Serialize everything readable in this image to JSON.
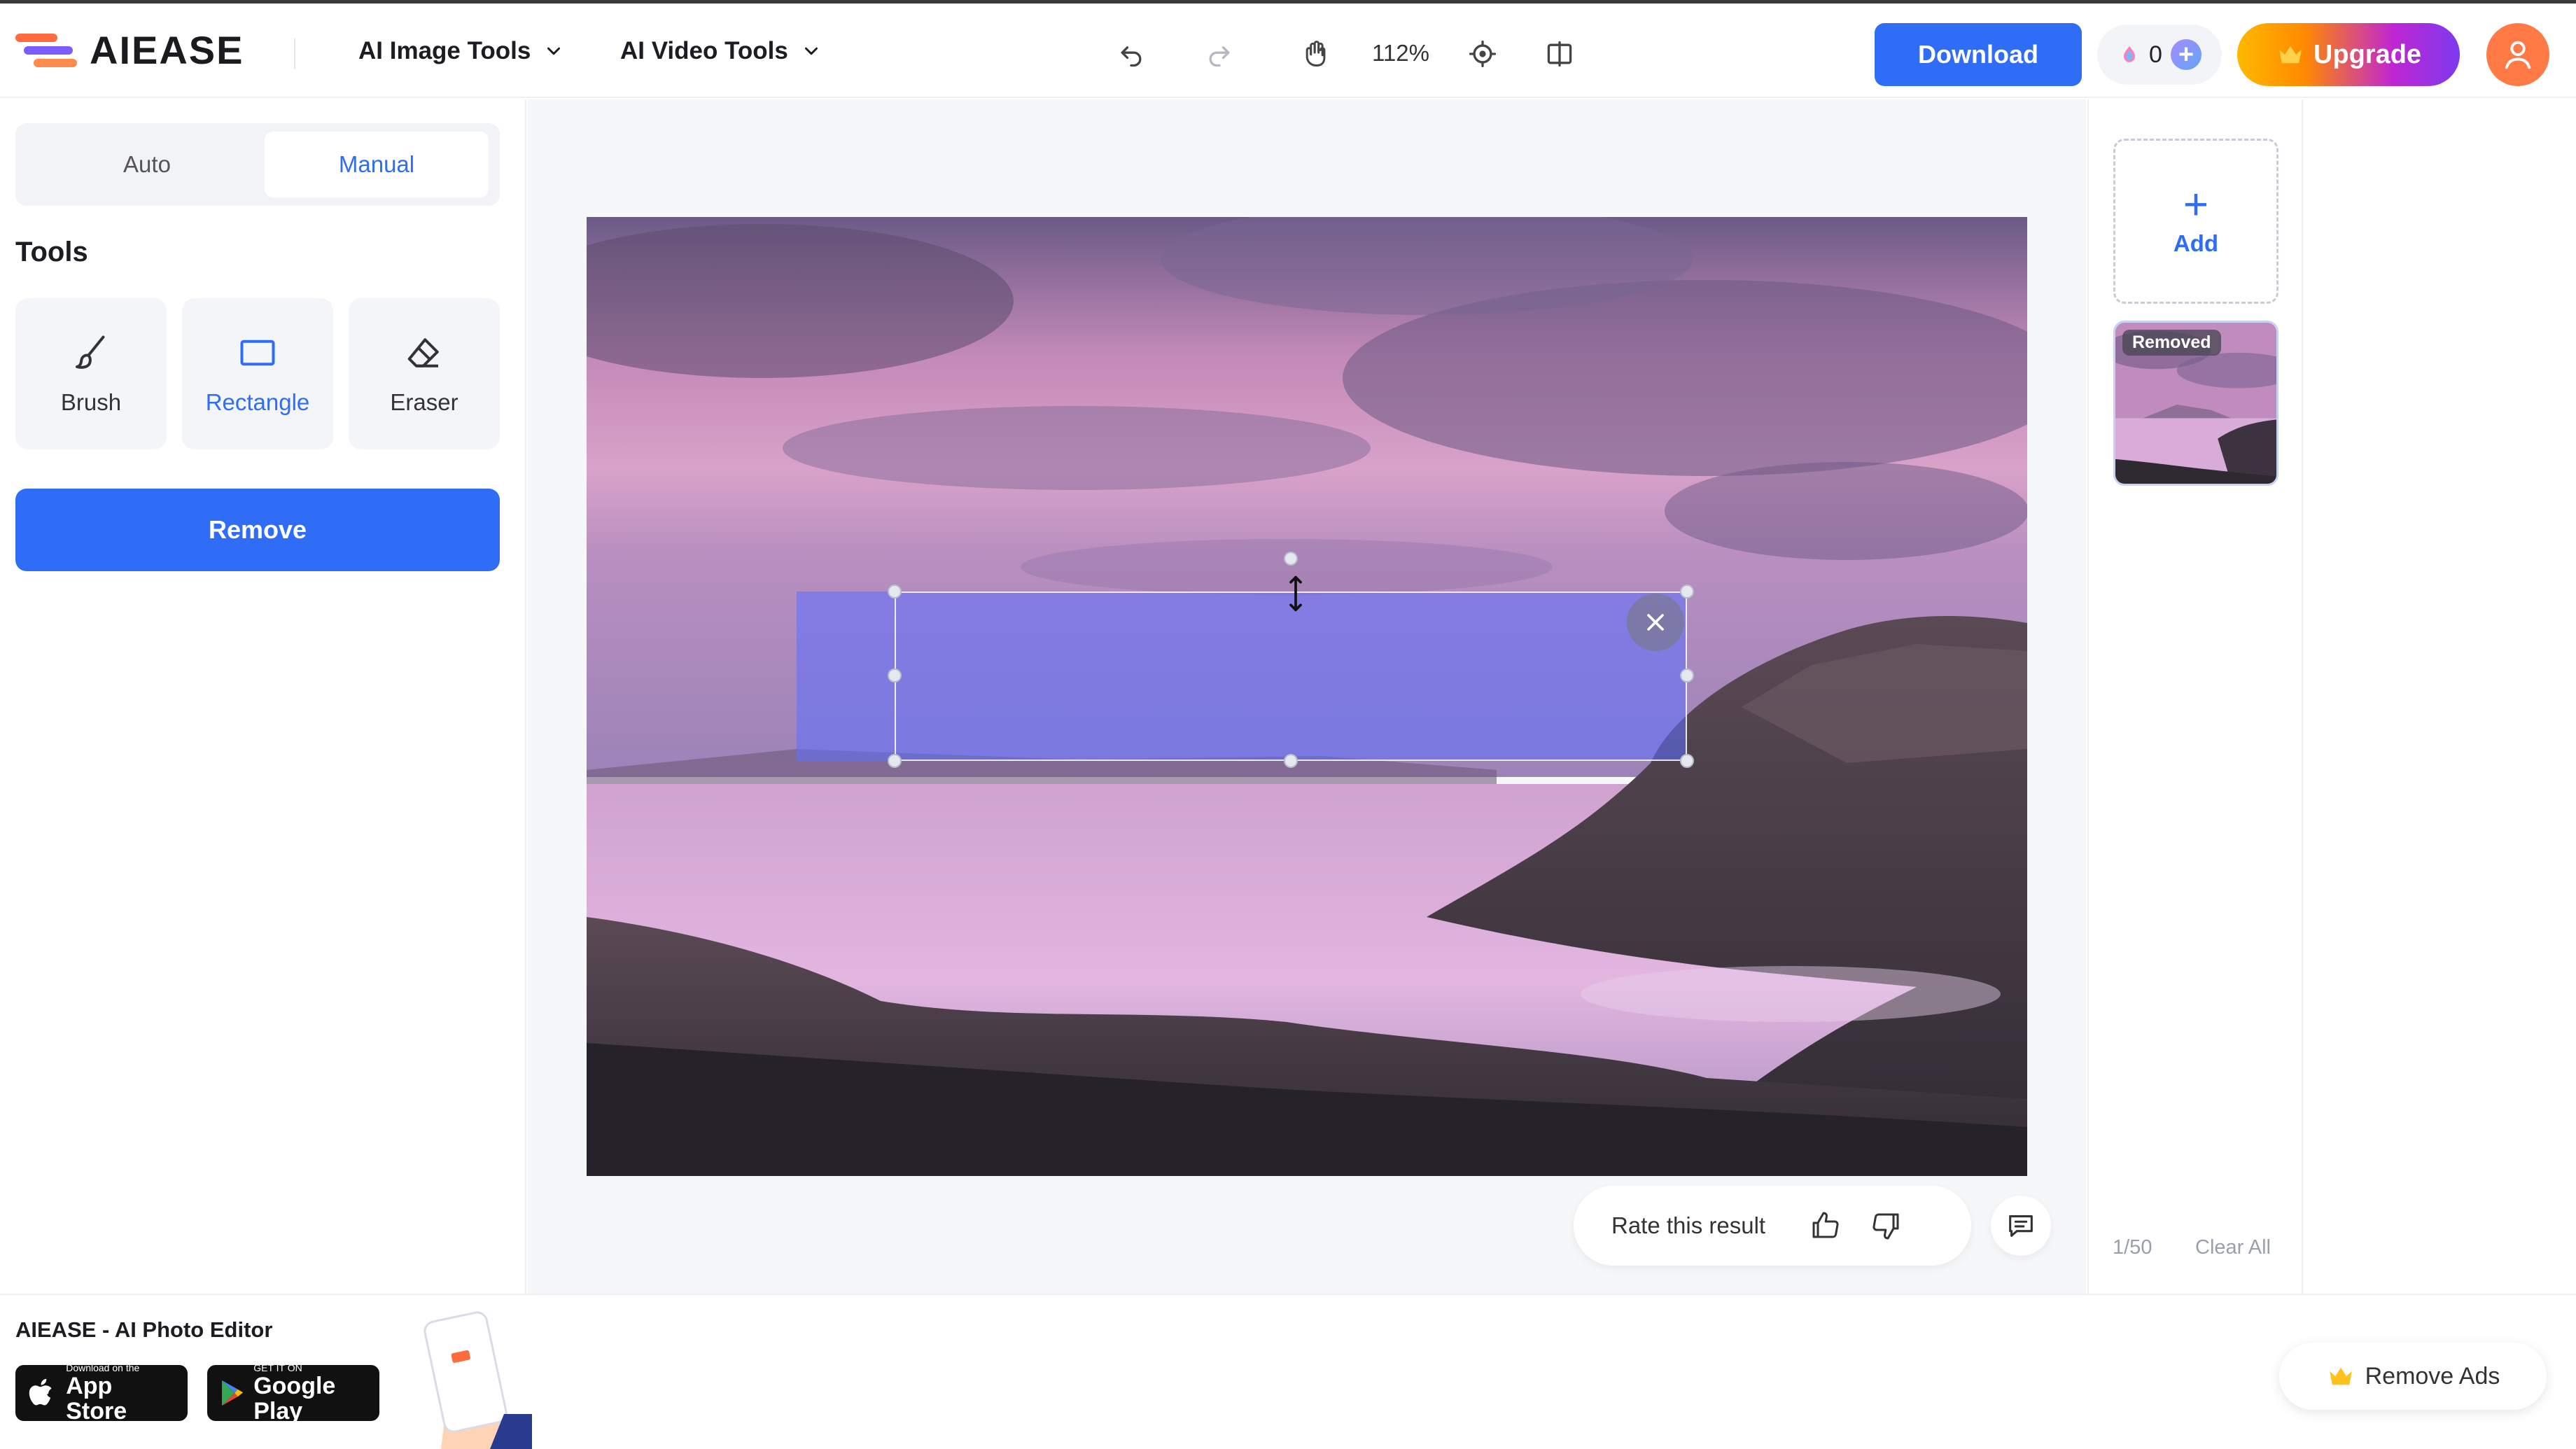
{
  "brand": {
    "name": "AIEASE"
  },
  "nav": {
    "image_tools": "AI Image Tools",
    "video_tools": "AI Video Tools"
  },
  "toolbar": {
    "zoom": "112%",
    "icons": [
      "undo-icon",
      "redo-icon",
      "hand-pan-icon",
      "fit-center-icon",
      "compare-icon"
    ]
  },
  "header_actions": {
    "download_label": "Download",
    "credits": "0",
    "upgrade_label": "Upgrade"
  },
  "left_panel": {
    "modes": [
      {
        "label": "Auto",
        "active": false
      },
      {
        "label": "Manual",
        "active": true
      }
    ],
    "tools_title": "Tools",
    "tools": [
      {
        "label": "Brush",
        "icon": "brush-icon",
        "active": false
      },
      {
        "label": "Rectangle",
        "icon": "rectangle-icon",
        "active": true
      },
      {
        "label": "Eraser",
        "icon": "eraser-icon",
        "active": false
      }
    ],
    "remove_label": "Remove"
  },
  "canvas": {
    "image_subject": "coastal rocks under a pink sunset sky",
    "rate_text": "Rate this result"
  },
  "right_panel": {
    "add_label": "Add",
    "thumb_badge": "Removed",
    "page_count": "1/50",
    "clear_all": "Clear All"
  },
  "promo": {
    "title": "AIEASE - AI Photo Editor",
    "app_store_small": "Download on the",
    "app_store_big": "App Store",
    "google_play_small": "GET IT ON",
    "google_play_big": "Google Play",
    "remove_ads": "Remove Ads"
  },
  "colors": {
    "accent": "#2f6df6",
    "avatar": "#ff7a45",
    "selection": "#5c70ff"
  }
}
